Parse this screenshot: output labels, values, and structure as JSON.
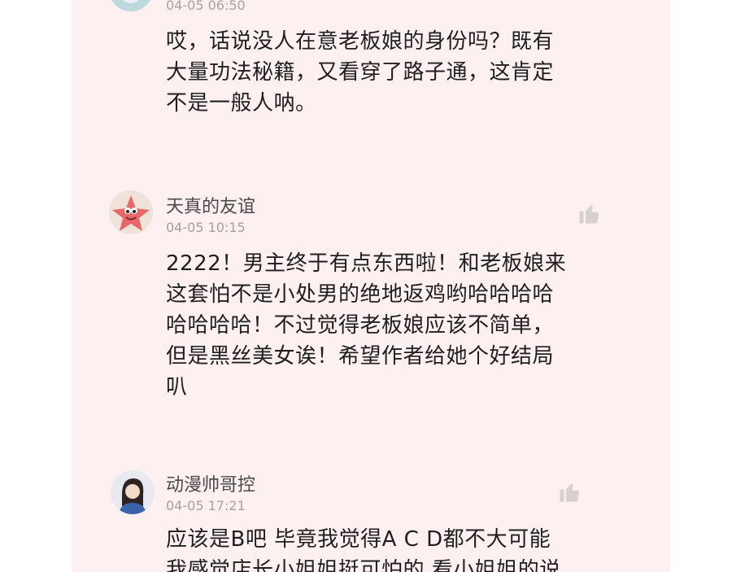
{
  "colors": {
    "panel_background": "#fcf0f0",
    "text_primary": "#1f1f1f",
    "username": "#4a4a4a",
    "timestamp": "#a8a0a0",
    "like_icon": "#d8d0d0"
  },
  "comments": [
    {
      "username": "",
      "time": "04-05 06:50",
      "avatar_icon": "avatar-partial",
      "lines": [
        "哎，话说没人在意老板娘的身份吗？既有",
        "大量功法秘籍，又看穿了路子通，这肯定",
        "不是一般人呐。"
      ]
    },
    {
      "username": "天真的友谊",
      "time": "04-05 10:15",
      "avatar_icon": "patrick-star-avatar",
      "like_icon": "thumbs-up-icon",
      "lines": [
        "2222！男主终于有点东西啦！和老板娘来",
        "这套怕不是小处男的绝地返鸡哟哈哈哈哈",
        "哈哈哈哈！不过觉得老板娘应该不简单，",
        "但是黑丝美女诶！希望作者给她个好结局",
        "叭"
      ]
    },
    {
      "username": "动漫帅哥控",
      "time": "04-05 17:21",
      "avatar_icon": "girl-avatar",
      "like_icon": "thumbs-up-icon",
      "lines": [
        "应该是B吧 毕竟我觉得A C D都不大可能",
        "我感觉店长小姐姐挺可怕的 看小姐姐的说"
      ]
    }
  ]
}
